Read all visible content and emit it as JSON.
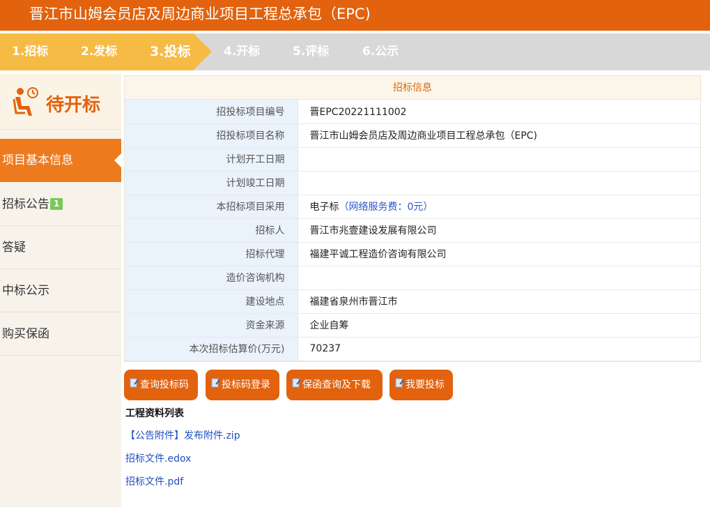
{
  "header": {
    "title": "晋江市山姆会员店及周边商业项目工程总承包（EPC)"
  },
  "steps": [
    "1.招标",
    "2.发标",
    "3.投标",
    "4.开标",
    "5.评标",
    "6.公示"
  ],
  "status": {
    "label": "待开标",
    "icon": "person-seat-clock-icon"
  },
  "sidebar": {
    "items": [
      {
        "label": "项目基本信息"
      },
      {
        "label": "招标公告",
        "badge": "1"
      },
      {
        "label": "答疑"
      },
      {
        "label": "中标公示"
      },
      {
        "label": "购买保函"
      }
    ]
  },
  "info": {
    "heading": "招标信息",
    "rows": [
      {
        "key": "招投标项目编号",
        "value": "晋EPC20221111002"
      },
      {
        "key": "招投标项目名称",
        "value": "晋江市山姆会员店及周边商业项目工程总承包（EPC)"
      },
      {
        "key": "计划开工日期",
        "value": ""
      },
      {
        "key": "计划竣工日期",
        "value": ""
      },
      {
        "key": "本招标项目采用",
        "value": "电子标",
        "note": "（网络服务费：0元）"
      },
      {
        "key": "招标人",
        "value": "晋江市兆壹建设发展有限公司"
      },
      {
        "key": "招标代理",
        "value": "福建平诚工程造价咨询有限公司"
      },
      {
        "key": "造价咨询机构",
        "value": ""
      },
      {
        "key": "建设地点",
        "value": "福建省泉州市晋江市"
      },
      {
        "key": "资金来源",
        "value": "企业自筹"
      },
      {
        "key": "本次招标估算价(万元)",
        "value": "70237"
      }
    ]
  },
  "actions": {
    "query_code": "查询投标码",
    "code_login": "投标码登录",
    "guarantee": "保函查询及下载",
    "bid": "我要投标"
  },
  "files": {
    "title": "工程资料列表",
    "items": [
      "【公告附件】发布附件.zip",
      "招标文件.edox",
      "招标文件.pdf"
    ]
  },
  "colors": {
    "accent": "#e2620d",
    "step_done": "#f5bb44",
    "link": "#1e4fc2"
  }
}
